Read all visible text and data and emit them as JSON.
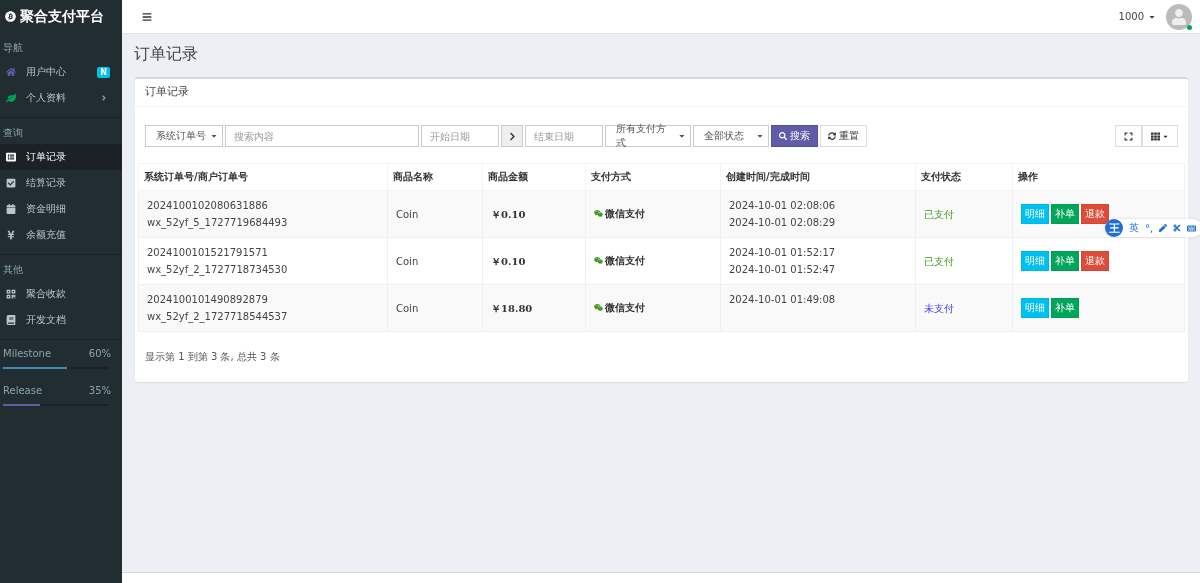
{
  "brand": {
    "title": "聚合支付平台"
  },
  "sidebar": {
    "sections": [
      {
        "heading": "导航",
        "items": [
          {
            "label": "用户中心",
            "selected": false,
            "badge": "N",
            "expandable": false
          },
          {
            "label": "个人资料",
            "selected": false,
            "expandable": true
          }
        ]
      },
      {
        "heading": "查询",
        "items": [
          {
            "label": "订单记录",
            "selected": true,
            "expandable": false
          },
          {
            "label": "结算记录",
            "selected": false,
            "expandable": false
          },
          {
            "label": "资金明细",
            "selected": false,
            "expandable": false
          },
          {
            "label": "余额充值",
            "selected": false,
            "expandable": false
          }
        ]
      },
      {
        "heading": "其他",
        "items": [
          {
            "label": "聚合收款",
            "selected": false,
            "expandable": false
          },
          {
            "label": "开发文档",
            "selected": false,
            "expandable": false
          }
        ]
      }
    ],
    "progress": [
      {
        "name": "Milestone",
        "reading": "60%",
        "level": 0.6,
        "color": "#3c8dbc"
      },
      {
        "name": "Release",
        "reading": "35%",
        "level": 0.35,
        "color": "#605ca8"
      }
    ]
  },
  "topbar": {
    "user": "1000",
    "online": true
  },
  "page_title": "订单记录",
  "card": {
    "title": "订单记录",
    "filters": {
      "field_select": "系统订单号",
      "search_placeholder": "搜索内容",
      "start_placeholder": "开始日期",
      "end_placeholder": "结束日期",
      "pay_select": "所有支付方式",
      "status_select": "全部状态",
      "search_button": "搜索",
      "reset_button": "重置"
    },
    "table": {
      "columns": [
        "系统订单号/商户订单号",
        "商品名称",
        "商品金额",
        "支付方式",
        "创建时间/完成时间",
        "支付状态",
        "操作"
      ],
      "rows": [
        {
          "order_no": "2024100102080631886",
          "merchant_no": "wx_52yf_5_1727719684493",
          "product": "Coin",
          "amount": "￥0.10",
          "payment": "微信支付",
          "created": "2024-10-01 02:08:06",
          "finished": "2024-10-01 02:08:29",
          "status": "已支付",
          "paid": true,
          "actions": [
            {
              "label": "明细",
              "kind": "info"
            },
            {
              "label": "补单",
              "kind": "success"
            },
            {
              "label": "退款",
              "kind": "danger"
            }
          ]
        },
        {
          "order_no": "2024100101521791571",
          "merchant_no": "wx_52yf_2_1727718734530",
          "product": "Coin",
          "amount": "￥0.10",
          "payment": "微信支付",
          "created": "2024-10-01 01:52:17",
          "finished": "2024-10-01 01:52:47",
          "status": "已支付",
          "paid": true,
          "actions": [
            {
              "label": "明细",
              "kind": "info"
            },
            {
              "label": "补单",
              "kind": "success"
            },
            {
              "label": "退款",
              "kind": "danger"
            }
          ]
        },
        {
          "order_no": "2024100101490892879",
          "merchant_no": "wx_52yf_2_1727718544537",
          "product": "Coin",
          "amount": "￥18.80",
          "payment": "微信支付",
          "created": "2024-10-01 01:49:08",
          "status": "未支付",
          "paid": false,
          "actions": [
            {
              "label": "明细",
              "kind": "info"
            },
            {
              "label": "补单",
              "kind": "success"
            }
          ]
        }
      ]
    },
    "pagination_info": "显示第 1 到第 3 条, 总共 3 条"
  },
  "ime_toolbar": {
    "logo": "王",
    "mode": "英",
    "punct": "°,"
  }
}
